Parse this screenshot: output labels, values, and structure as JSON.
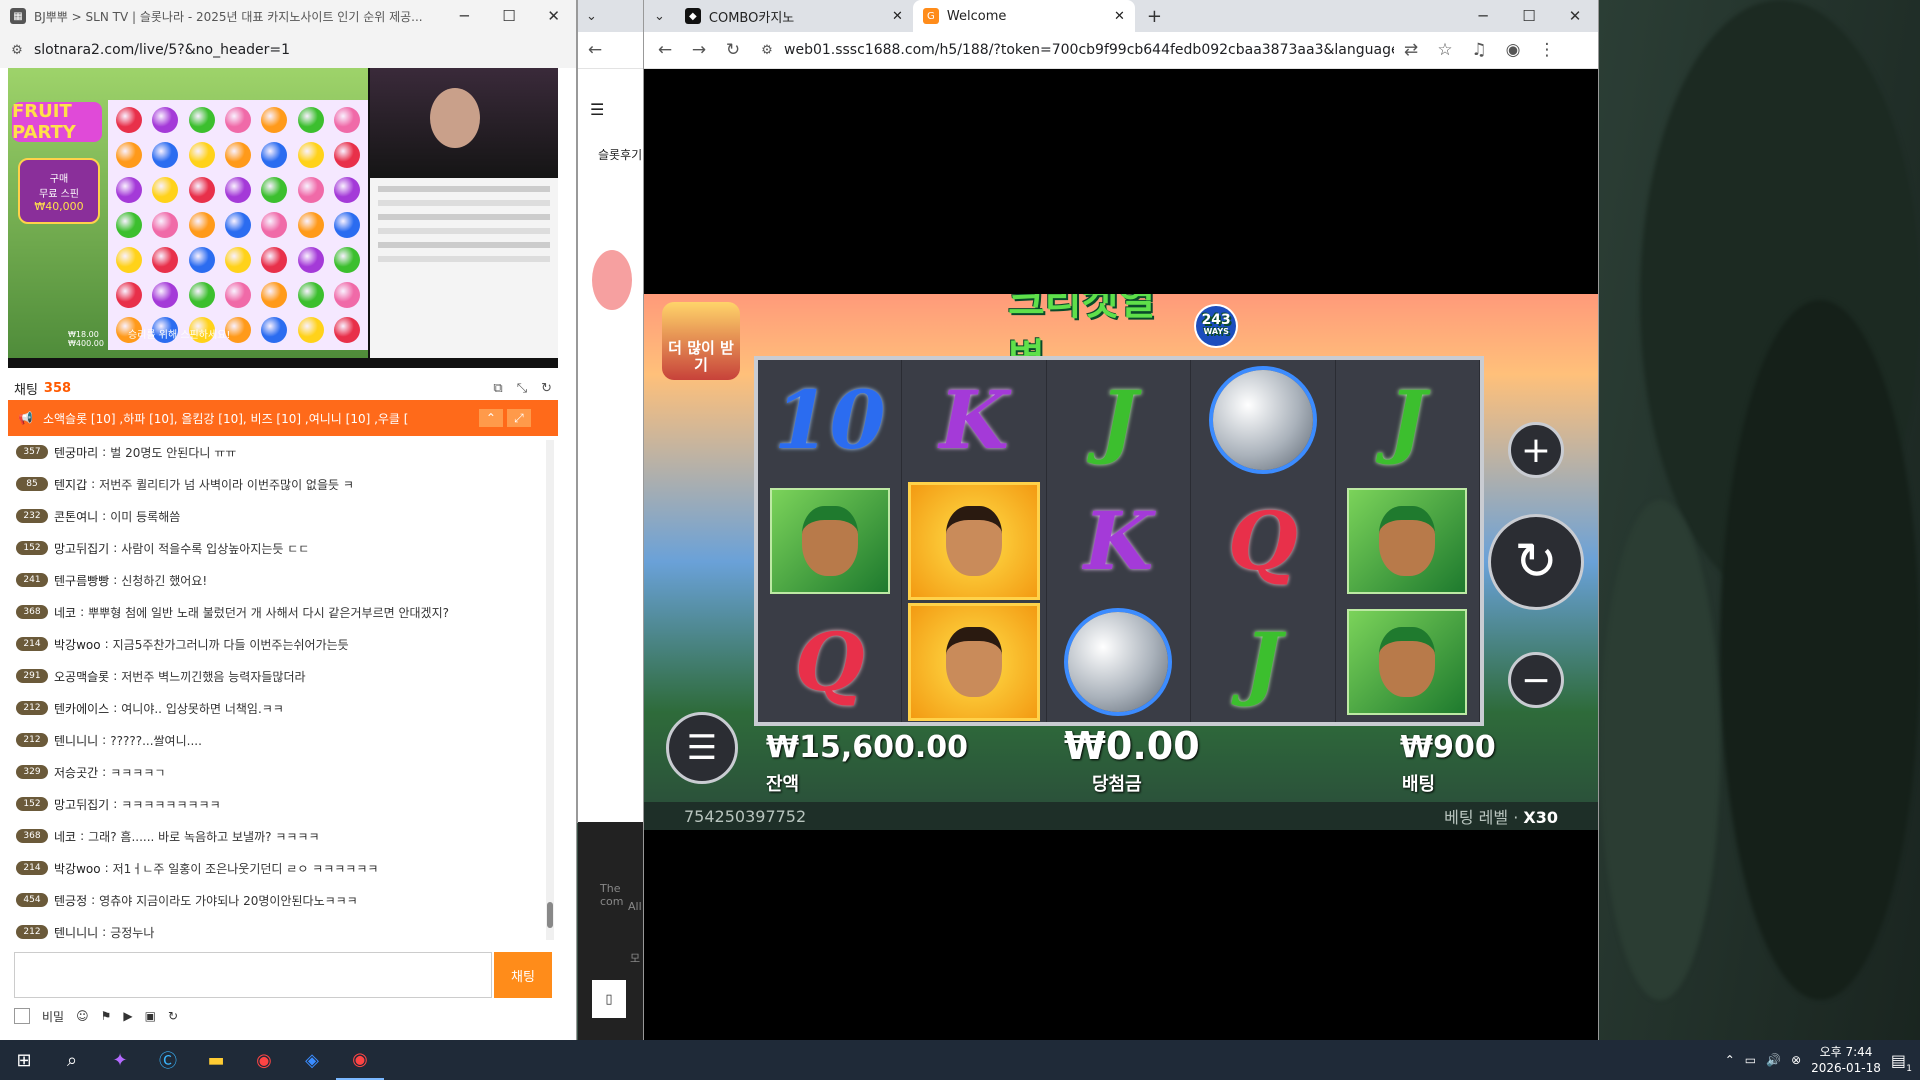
{
  "left_window": {
    "tab_title": "BJ뿌뿌 > SLN TV | 슬롯나라 - 2025년 대표 카지노사이트 인기 순위 제공...",
    "url": "slotnara2.com/live/5?&no_header=1",
    "stream": {
      "buy_label": "구매",
      "free_spin_label": "무료 스핀",
      "buy_price": "₩40,000",
      "bet_line1": "₩18.00",
      "bet_line2": "₩400.00",
      "spin_hint": "승리를 위해 스핀하세요!"
    },
    "chat": {
      "label": "채팅",
      "count": "358",
      "notice": "소액슬롯 [10] ,하파 [10], 올킴강 [10], 비즈 [10] ,여니니 [10] ,우클 [",
      "messages": [
        {
          "level": "357",
          "nick": "텐궁마리",
          "text": "벌 20명도 안된다니 ㅠㅠ"
        },
        {
          "level": "85",
          "nick": "텐지갑",
          "text": "저번주 퀼리티가 넘 사벽이라 이번주많이 없을듯 ㅋ"
        },
        {
          "level": "232",
          "nick": "콘톤여니",
          "text": "이미 등록해씀"
        },
        {
          "level": "152",
          "nick": "망고뒤집기",
          "text": "사람이 적을수록 입상높아지는듯 ㄷㄷ"
        },
        {
          "level": "241",
          "nick": "텐구름빵빵",
          "text": "신청하긴 했어요!"
        },
        {
          "level": "368",
          "nick": "네코",
          "text": "뿌뿌형 첨에 일반 노래 불렀던거 개 사해서 다시 같은거부르면 안대겠지?"
        },
        {
          "level": "214",
          "nick": "박강woo",
          "text": "지금5주찬가그러니까 다들 이번주는쉬어가는듯"
        },
        {
          "level": "291",
          "nick": "오공맥슬롯",
          "text": "저번주 벽느끼긴했음 능력자들많더라"
        },
        {
          "level": "212",
          "nick": "텐카에이스",
          "text": "여니야.. 입상못하면 너책임.ㅋㅋ"
        },
        {
          "level": "212",
          "nick": "텐니니니",
          "text": "?????...쌀여니...."
        },
        {
          "level": "329",
          "nick": "저승곳간",
          "text": "ㅋㅋㅋㅋㄱ"
        },
        {
          "level": "152",
          "nick": "망고뒤집기",
          "text": "ㅋㅋㅋㅋㅋㅋㅋㅋㅋ"
        },
        {
          "level": "368",
          "nick": "네코",
          "text": "그래? 흠...... 바로 녹음하고 보낼까? ㅋㅋㅋㅋ"
        },
        {
          "level": "214",
          "nick": "박강woo",
          "text": "저1ㅓㄴ주 일홍이 조은나웃기던디 ㄹㅇ ㅋㅋㅋㅋㅋㅋ"
        },
        {
          "level": "454",
          "nick": "텐긍정",
          "text": "영츄야 지금이라도 가야되나 20명이안된다노ㅋㅋㅋ"
        },
        {
          "level": "212",
          "nick": "텐니니니",
          "text": "긍정누나"
        }
      ],
      "send_label": "채팅",
      "secret_label": "비밀"
    }
  },
  "middle_window": {
    "partial_tab_text": "슬롯후기",
    "footer_text1": "The com",
    "footer_text2": "All",
    "footer_text3": "모"
  },
  "right_window": {
    "tabs": [
      {
        "label": "COMBO카지노"
      },
      {
        "label": "Welcome"
      }
    ],
    "url": "web01.sssc1688.com/h5/188/?token=700cb9f99cb644fedb092cbaa3873aa3&language=ko&...",
    "game": {
      "title": "크리켓열병",
      "ways_number": "243",
      "ways_label": "WAYS",
      "more_button": "더 많이 받기",
      "reels": [
        [
          "10",
          "batsman",
          "Q"
        ],
        [
          "K",
          "bowler",
          "bowler"
        ],
        [
          "J",
          "K",
          "ball"
        ],
        [
          "ball",
          "Q",
          "J"
        ],
        [
          "J",
          "batsman",
          "batsman"
        ]
      ],
      "balance_value": "₩15,600.00",
      "balance_label": "잔액",
      "win_value": "₩0.00",
      "win_label": "당첨금",
      "bet_value": "₩900",
      "bet_label": "배팅",
      "round_id": "754250397752",
      "bet_level_label": "베팅 레벨 · ",
      "bet_level_value": "X30"
    }
  },
  "taskbar": {
    "time": "오후 7:44",
    "date": "2026-01-18",
    "notification_count": "1"
  }
}
